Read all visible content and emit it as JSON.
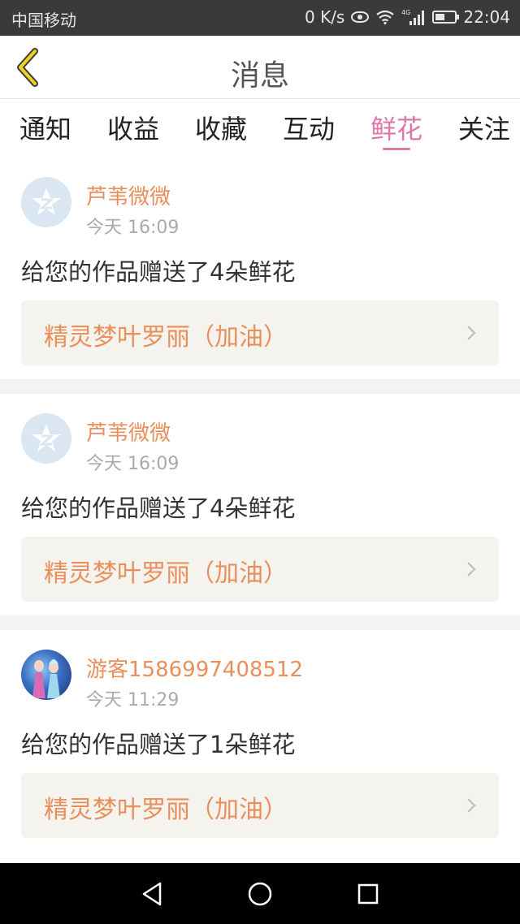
{
  "status_bar": {
    "carrier": "中国移动",
    "net_speed": "0 K/s",
    "network_type": "4G",
    "time": "22:04"
  },
  "header": {
    "title": "消息"
  },
  "tabs": [
    {
      "label": "通知",
      "active": false
    },
    {
      "label": "收益",
      "active": false
    },
    {
      "label": "收藏",
      "active": false
    },
    {
      "label": "互动",
      "active": false
    },
    {
      "label": "鲜花",
      "active": true
    },
    {
      "label": "关注",
      "active": false
    }
  ],
  "messages": [
    {
      "user": "芦苇微微",
      "time": "今天 16:09",
      "text": "给您的作品赠送了4朵鲜花",
      "work": "精灵梦叶罗丽（加油）",
      "avatar": "default"
    },
    {
      "user": "芦苇微微",
      "time": "今天 16:09",
      "text": "给您的作品赠送了4朵鲜花",
      "work": "精灵梦叶罗丽（加油）",
      "avatar": "default"
    },
    {
      "user": "游客1586997408512",
      "time": "今天 11:29",
      "text": "给您的作品赠送了1朵鲜花",
      "work": "精灵梦叶罗丽（加油）",
      "avatar": "photo"
    }
  ],
  "colors": {
    "accent": "#e076a8",
    "username": "#e88f5c",
    "card_link_bg": "#f5f3ee"
  }
}
